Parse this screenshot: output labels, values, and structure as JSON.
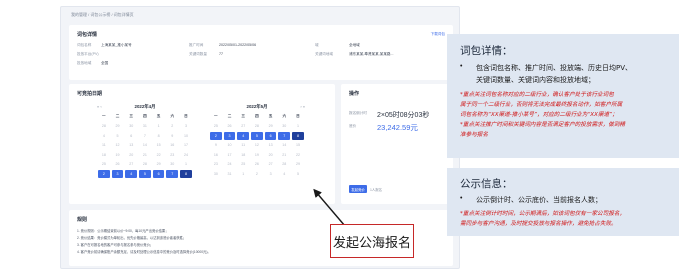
{
  "breadcrumb": "我的管理 / 词包公示榜 / 词包详情页",
  "detail": {
    "title": "词包详情",
    "link": "下载词包",
    "labels": [
      "词包名称",
      "推广时间",
      "城",
      "投放平台(PV)",
      "关键词数量",
      "关键词地域",
      "投放地域"
    ],
    "values": [
      "上海某某_推小某号",
      "2022/05/01-2022/05/06",
      "全地域",
      "",
      "77",
      "浦东某某,奉贤某某,某某路...",
      "全国"
    ]
  },
  "calendar": {
    "title": "可竞拍日期",
    "months": [
      "2022年4月",
      "2022年5月"
    ],
    "weekdays": [
      "一",
      "二",
      "三",
      "四",
      "五",
      "六",
      "日"
    ],
    "april": [
      "28",
      "29",
      "30",
      "31",
      "1",
      "2",
      "3",
      "4",
      "5",
      "6",
      "7",
      "8",
      "9",
      "10",
      "11",
      "12",
      "13",
      "14",
      "15",
      "16",
      "17",
      "18",
      "19",
      "20",
      "21",
      "22",
      "23",
      "24",
      "25",
      "26",
      "27",
      "28",
      "29",
      "30",
      "1",
      "2",
      "3",
      "4",
      "5",
      "6",
      "7",
      "8"
    ],
    "may": [
      "25",
      "26",
      "27",
      "28",
      "29",
      "30",
      "1",
      "2",
      "3",
      "4",
      "5",
      "6",
      "7",
      "8",
      "9",
      "10",
      "11",
      "12",
      "13",
      "14",
      "15",
      "16",
      "17",
      "18",
      "19",
      "20",
      "21",
      "22",
      "23",
      "24",
      "25",
      "26",
      "27",
      "28",
      "29",
      "30",
      "31",
      "1",
      "2",
      "3",
      "4",
      "5"
    ]
  },
  "operation": {
    "title": "操作",
    "countdown_label": "报名倒计时",
    "countdown": "2×05时08分03秒",
    "price_label": "底价",
    "price": "23,242.59元",
    "button": "发起竞价",
    "button_note": "1人报名"
  },
  "rules": {
    "title": "规则",
    "lines": [
      "1. 竞价规则：公示期结束前以价~9:00，每10元产出竞价结果；",
      "2. 竞价结果：竞价模式为单轮出，优先价格最高，以达到该底价者者获胜；",
      "3. 客户在可报名地的客户可参与报名参与竞价竞价；",
      "4. 客户竞价前请确保账户余额充足，请及时处理公示信息中的竞价及时选择竞价(10000元)。"
    ]
  },
  "callout": "发起公海报名",
  "panel1": {
    "title": "词包详情：",
    "bullet_lines": [
      "包含词包名称、推广时间、投放端、历史日均PV、",
      "关键词数量、关键词内容和投放地域；"
    ],
    "red_lines": [
      "*重点关注词包名称对应的二级行业，确认客户处于该行业词包",
      "属于同一个二级行业，否则将无法完成最终报名动作，如客户所属",
      "词包名称为“XX渠道-推小某号”，对应的二级行业为“XX渠道”；",
      "*重点关注推广时间和关键词内容是否满足客户的投放需求，做到精",
      "准参与报名"
    ]
  },
  "panel2": {
    "title": "公示信息：",
    "bullet_lines": [
      "公示倒计时、公示底价、当前报名人数；"
    ],
    "red_lines": [
      "*重点关注倒计时时间，公示期满后，如该词包仅有一家公司报名，",
      "需同步与客户沟通，及时提交投放与报名操作，避免抢占失败。"
    ]
  },
  "colors": {
    "accent": "#3d6ce8",
    "red": "#d01414",
    "panel": "#dfe7f2"
  }
}
